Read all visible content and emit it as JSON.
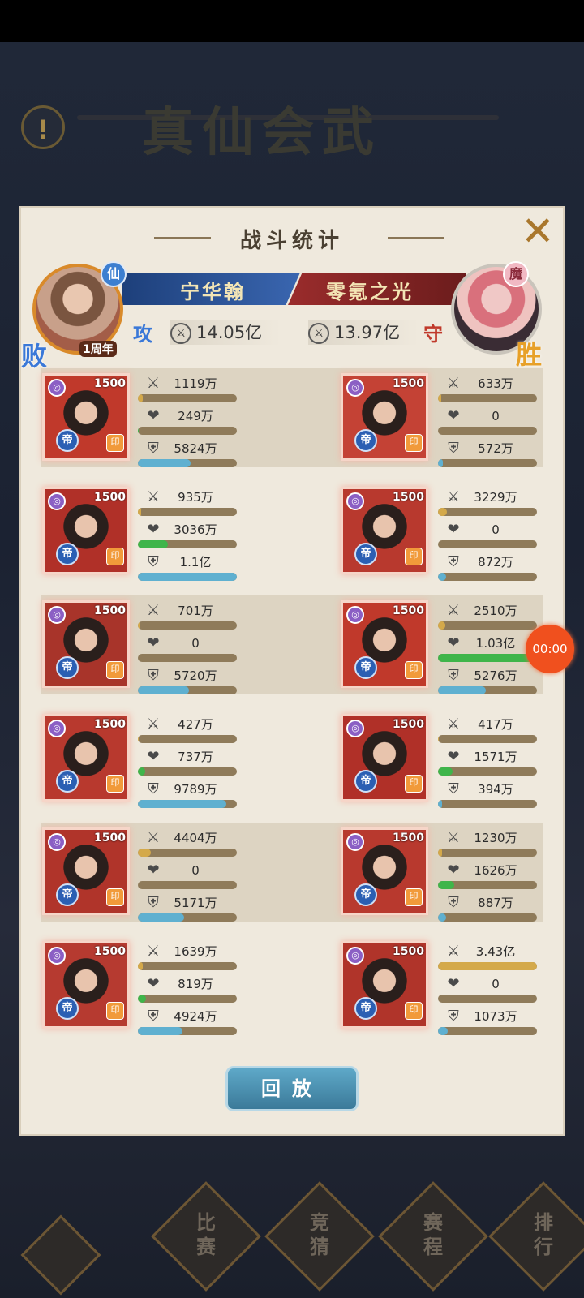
{
  "background": {
    "title": "真仙会武"
  },
  "panel": {
    "title": "战斗统计",
    "close_icon": "close-x"
  },
  "players": {
    "left": {
      "name": "宁华翰",
      "role": "攻",
      "result": "败",
      "power": "14.05亿",
      "badge": "1周年",
      "faction": "仙"
    },
    "right": {
      "name": "零氪之光",
      "role": "守",
      "result": "胜",
      "power": "13.97亿",
      "faction": "魔"
    }
  },
  "rows": [
    {
      "left": {
        "level": "1500",
        "rank": "帝",
        "atk": "1119万",
        "hp": "249万",
        "def": "5824万",
        "atk_pct": 0.05,
        "hp_pct": 0.01,
        "def_pct": 0.53
      },
      "right": {
        "level": "1500",
        "rank": "帝",
        "atk": "633万",
        "hp": "0",
        "def": "572万",
        "atk_pct": 0.03,
        "hp_pct": 0,
        "def_pct": 0.05
      }
    },
    {
      "left": {
        "level": "1500",
        "rank": "帝",
        "atk": "935万",
        "hp": "3036万",
        "def": "1.1亿",
        "atk_pct": 0.03,
        "hp_pct": 0.3,
        "def_pct": 1.0
      },
      "right": {
        "level": "1500",
        "rank": "帝",
        "atk": "3229万",
        "hp": "0",
        "def": "872万",
        "atk_pct": 0.09,
        "hp_pct": 0,
        "def_pct": 0.08
      }
    },
    {
      "left": {
        "level": "1500",
        "rank": "帝",
        "atk": "701万",
        "hp": "0",
        "def": "5720万",
        "atk_pct": 0.02,
        "hp_pct": 0,
        "def_pct": 0.52
      },
      "right": {
        "level": "1500",
        "rank": "帝",
        "atk": "2510万",
        "hp": "1.03亿",
        "def": "5276万",
        "atk_pct": 0.07,
        "hp_pct": 1.0,
        "def_pct": 0.48
      }
    },
    {
      "left": {
        "level": "1500",
        "rank": "帝",
        "atk": "427万",
        "hp": "737万",
        "def": "9789万",
        "atk_pct": 0.01,
        "hp_pct": 0.07,
        "def_pct": 0.89
      },
      "right": {
        "level": "1500",
        "rank": "帝",
        "atk": "417万",
        "hp": "1571万",
        "def": "394万",
        "atk_pct": 0.01,
        "hp_pct": 0.15,
        "def_pct": 0.04
      }
    },
    {
      "left": {
        "level": "1500",
        "rank": "帝",
        "atk": "4404万",
        "hp": "0",
        "def": "5171万",
        "atk_pct": 0.13,
        "hp_pct": 0,
        "def_pct": 0.47
      },
      "right": {
        "level": "1500",
        "rank": "帝",
        "atk": "1230万",
        "hp": "1626万",
        "def": "887万",
        "atk_pct": 0.04,
        "hp_pct": 0.16,
        "def_pct": 0.08
      }
    },
    {
      "left": {
        "level": "1500",
        "rank": "帝",
        "atk": "1639万",
        "hp": "819万",
        "def": "4924万",
        "atk_pct": 0.05,
        "hp_pct": 0.08,
        "def_pct": 0.45
      },
      "right": {
        "level": "1500",
        "rank": "帝",
        "atk": "3.43亿",
        "hp": "0",
        "def": "1073万",
        "atk_pct": 1.0,
        "hp_pct": 0,
        "def_pct": 0.1
      }
    }
  ],
  "buttons": {
    "replay": "回放"
  },
  "timer": "00:00",
  "nav": [
    {
      "label": "比\n赛"
    },
    {
      "label": "竞\n猜"
    },
    {
      "label": "赛\n程"
    },
    {
      "label": "排\n行"
    }
  ],
  "colors": {
    "attack": "#d4a94a",
    "health": "#3fb54a",
    "defense": "#5fb0d0",
    "win": "#e7a028",
    "lose": "#3a78d8"
  }
}
